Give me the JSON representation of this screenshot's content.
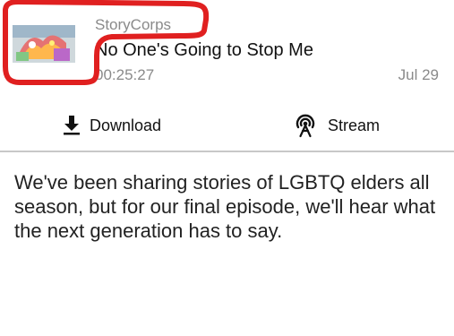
{
  "episode": {
    "publisher": "StoryCorps",
    "title": "No One's Going to Stop Me",
    "duration": "00:25:27",
    "date": "Jul 29",
    "thumbnail_icon": "podcast-artwork"
  },
  "actions": {
    "download_label": "Download",
    "download_icon": "download-icon",
    "stream_label": "Stream",
    "stream_icon": "broadcast-icon"
  },
  "description": "We've been sharing stories of LGBTQ elders all season, but for our final episode, we'll hear what the next generation has to say.",
  "colors": {
    "annotation": "#e02020",
    "secondary_text": "#8a8a8a",
    "primary_text": "#111111",
    "divider": "#c8c8c8"
  }
}
